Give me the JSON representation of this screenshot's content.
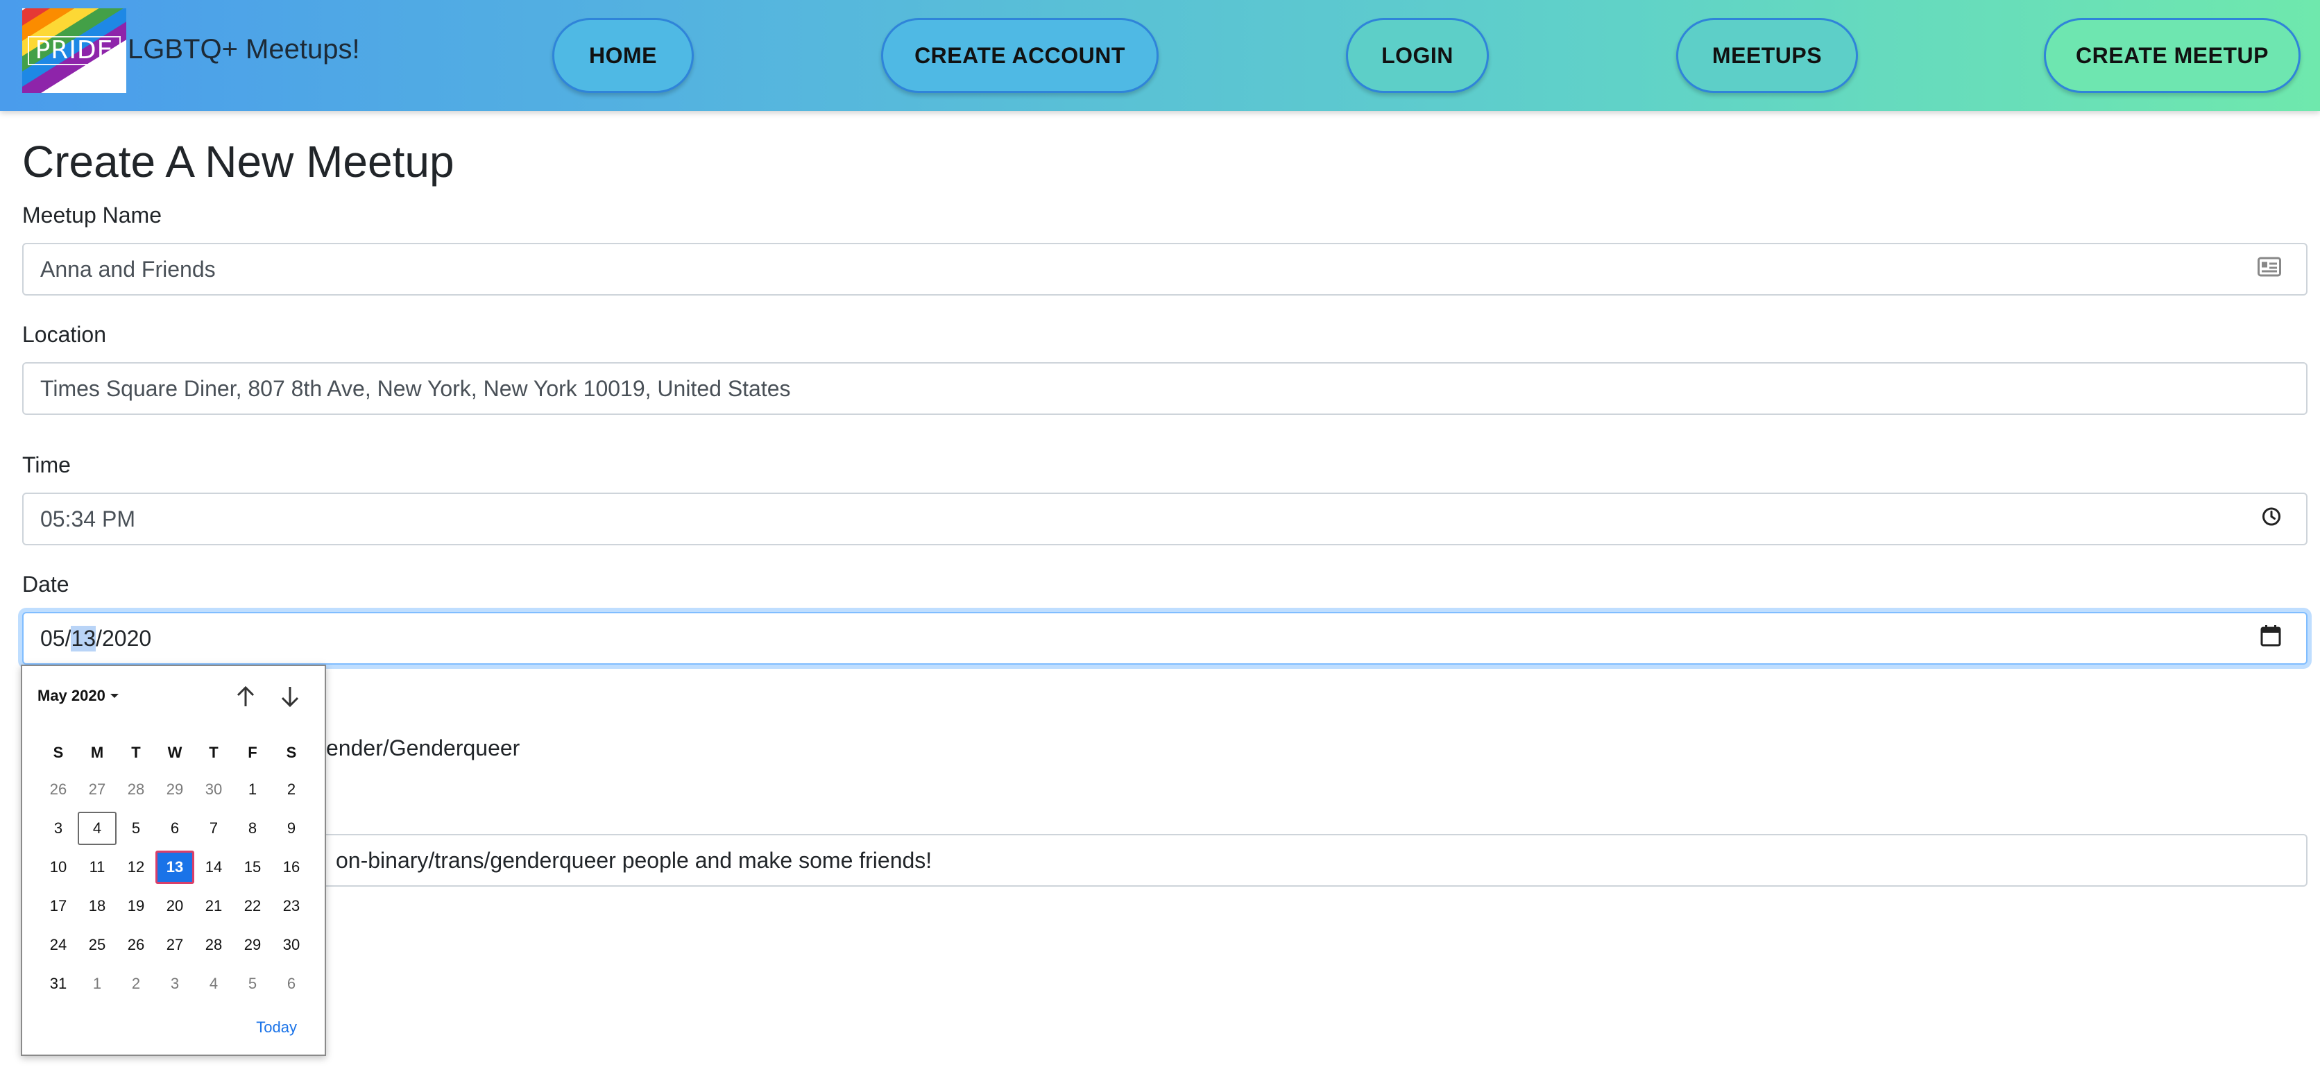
{
  "brand": {
    "logo_text": "PRIDE",
    "title": "LGBTQ+ Meetups!",
    "logo_colors": [
      "#e53935",
      "#fb8c00",
      "#fdd835",
      "#43a047",
      "#1e88e5",
      "#8e24aa"
    ]
  },
  "nav": {
    "home": "HOME",
    "create_account": "CREATE ACCOUNT",
    "login": "LOGIN",
    "meetups": "MEETUPS",
    "create_meetup": "CREATE MEETUP"
  },
  "page": {
    "title": "Create A New Meetup"
  },
  "form": {
    "meetup_name": {
      "label": "Meetup Name",
      "value": "Anna and Friends"
    },
    "location": {
      "label": "Location",
      "value": "Times Square Diner, 807 8th Ave, New York, New York 10019, United States"
    },
    "time": {
      "label": "Time",
      "value": "05:34 PM"
    },
    "date": {
      "label": "Date",
      "month": "05",
      "day": "13",
      "year": "2020"
    },
    "category_partial": "ender/Genderqueer",
    "description_partial": "on-binary/trans/genderqueer people and make some friends!"
  },
  "calendar": {
    "month_label": "May 2020",
    "days_of_week": [
      "S",
      "M",
      "T",
      "W",
      "T",
      "F",
      "S"
    ],
    "weeks": [
      [
        {
          "d": "26",
          "m": true
        },
        {
          "d": "27",
          "m": true
        },
        {
          "d": "28",
          "m": true
        },
        {
          "d": "29",
          "m": true
        },
        {
          "d": "30",
          "m": true
        },
        {
          "d": "1"
        },
        {
          "d": "2"
        }
      ],
      [
        {
          "d": "3"
        },
        {
          "d": "4",
          "today": true
        },
        {
          "d": "5"
        },
        {
          "d": "6"
        },
        {
          "d": "7"
        },
        {
          "d": "8"
        },
        {
          "d": "9"
        }
      ],
      [
        {
          "d": "10"
        },
        {
          "d": "11"
        },
        {
          "d": "12"
        },
        {
          "d": "13",
          "selected": true
        },
        {
          "d": "14"
        },
        {
          "d": "15"
        },
        {
          "d": "16"
        }
      ],
      [
        {
          "d": "17"
        },
        {
          "d": "18"
        },
        {
          "d": "19"
        },
        {
          "d": "20"
        },
        {
          "d": "21"
        },
        {
          "d": "22"
        },
        {
          "d": "23"
        }
      ],
      [
        {
          "d": "24"
        },
        {
          "d": "25"
        },
        {
          "d": "26"
        },
        {
          "d": "27"
        },
        {
          "d": "28"
        },
        {
          "d": "29"
        },
        {
          "d": "30"
        }
      ],
      [
        {
          "d": "31"
        },
        {
          "d": "1",
          "m": true
        },
        {
          "d": "2",
          "m": true
        },
        {
          "d": "3",
          "m": true
        },
        {
          "d": "4",
          "m": true
        },
        {
          "d": "5",
          "m": true
        },
        {
          "d": "6",
          "m": true
        }
      ]
    ],
    "today_label": "Today"
  }
}
